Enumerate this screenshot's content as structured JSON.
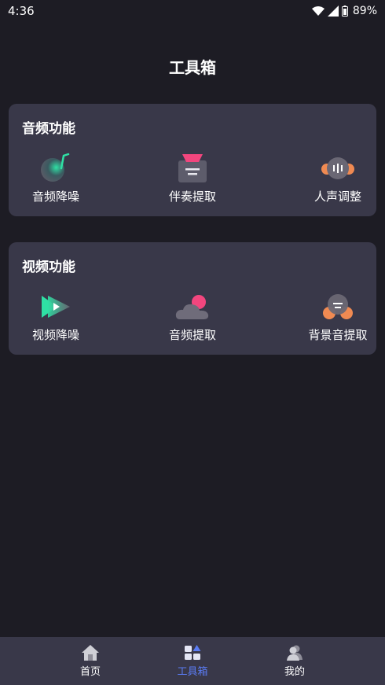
{
  "status_bar": {
    "time": "4:36",
    "battery": "89%"
  },
  "page": {
    "title": "工具箱"
  },
  "audio_section": {
    "title": "音频功能",
    "tools": [
      {
        "label": "音频降噪",
        "icon": "audio-denoise-icon"
      },
      {
        "label": "伴奏提取",
        "icon": "accompaniment-extract-icon"
      },
      {
        "label": "人声调整",
        "icon": "vocal-adjust-icon"
      }
    ]
  },
  "video_section": {
    "title": "视频功能",
    "tools": [
      {
        "label": "视频降噪",
        "icon": "video-denoise-icon"
      },
      {
        "label": "音频提取",
        "icon": "audio-extract-icon"
      },
      {
        "label": "背景音提取",
        "icon": "background-sound-extract-icon"
      }
    ]
  },
  "tab_bar": {
    "tabs": [
      {
        "label": "首页",
        "icon": "home-icon",
        "active": false
      },
      {
        "label": "工具箱",
        "icon": "toolbox-icon",
        "active": true
      },
      {
        "label": "我的",
        "icon": "user-icon",
        "active": false
      }
    ],
    "active_color": "#5a7bf2"
  },
  "colors": {
    "background": "#1d1c24",
    "card": "#393849",
    "accent": "#5a7bf2"
  }
}
